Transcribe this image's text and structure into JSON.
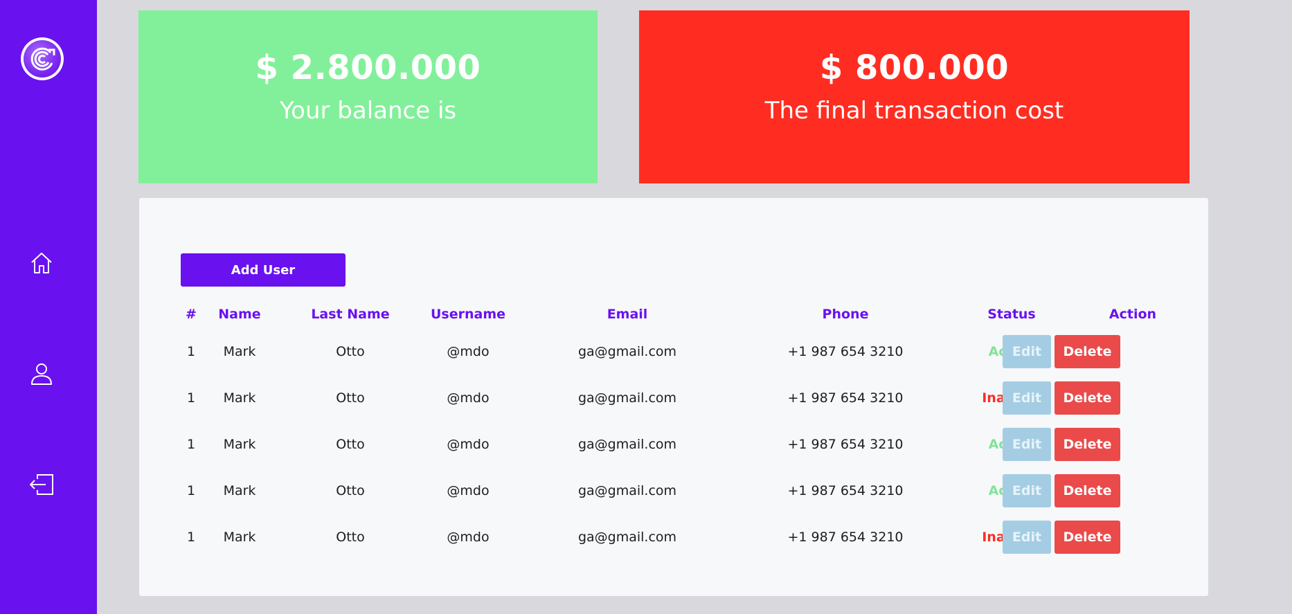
{
  "sidebar": {
    "logo": "bittorrent-logo",
    "items": [
      {
        "icon": "home-icon"
      },
      {
        "icon": "user-icon"
      },
      {
        "icon": "logout-icon"
      }
    ],
    "color": "#6a11f0"
  },
  "cards": {
    "balance": {
      "amount": "$ 2.800.000",
      "caption": "Your balance is",
      "color": "#82f09a"
    },
    "cost": {
      "amount": "$ 800.000",
      "caption": "The final transaction cost",
      "color": "#ff2d21"
    }
  },
  "panel": {
    "add_user_label": "Add User",
    "table": {
      "headers": [
        "#",
        "Name",
        "Last Name",
        "Username",
        "Email",
        "Phone",
        "Status",
        "Action"
      ],
      "rows": [
        {
          "num": "1",
          "name": "Mark",
          "last": "Otto",
          "username": "@mdo",
          "email": "ga@gmail.com",
          "phone": "+1 987 654 3210",
          "status": "Active"
        },
        {
          "num": "1",
          "name": "Mark",
          "last": "Otto",
          "username": "@mdo",
          "email": "ga@gmail.com",
          "phone": "+1 987 654 3210",
          "status": "Inactive"
        },
        {
          "num": "1",
          "name": "Mark",
          "last": "Otto",
          "username": "@mdo",
          "email": "ga@gmail.com",
          "phone": "+1 987 654 3210",
          "status": "Active"
        },
        {
          "num": "1",
          "name": "Mark",
          "last": "Otto",
          "username": "@mdo",
          "email": "ga@gmail.com",
          "phone": "+1 987 654 3210",
          "status": "Active"
        },
        {
          "num": "1",
          "name": "Mark",
          "last": "Otto",
          "username": "@mdo",
          "email": "ga@gmail.com",
          "phone": "+1 987 654 3210",
          "status": "Inactive"
        }
      ],
      "edit_label": "Edit",
      "delete_label": "Delete"
    },
    "colors": {
      "active": "#82e39a",
      "inactive": "#ff2d21",
      "accent": "#6a11f0"
    }
  }
}
